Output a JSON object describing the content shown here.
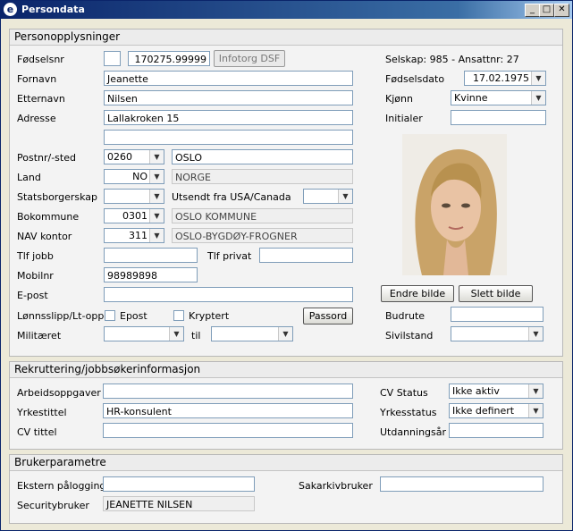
{
  "window": {
    "title": "Persondata",
    "minimize": "_",
    "maximize": "□",
    "close": "✕"
  },
  "sections": {
    "person": "Personopplysninger",
    "recruit": "Rekruttering/jobbsøkerinformasjon",
    "user": "Brukerparametre"
  },
  "person": {
    "fodselsnr": {
      "label": "Fødselsnr",
      "value": "170275.99999",
      "button": "Infotorg DSF"
    },
    "fornavn": {
      "label": "Fornavn",
      "value": "Jeanette"
    },
    "etternavn": {
      "label": "Etternavn",
      "value": "Nilsen"
    },
    "adresse": {
      "label": "Adresse",
      "value": "Lallakroken 15",
      "value2": ""
    },
    "postnr": {
      "label": "Postnr/-sted",
      "code": "0260",
      "place": "OSLO"
    },
    "land": {
      "label": "Land",
      "code": "NO",
      "name": "NORGE"
    },
    "statsborgerskap": {
      "label": "Statsborgerskap",
      "value": ""
    },
    "utsendt": {
      "label": "Utsendt fra USA/Canada",
      "value": ""
    },
    "bokommune": {
      "label": "Bokommune",
      "code": "0301",
      "name": "OSLO KOMMUNE"
    },
    "navkontor": {
      "label": "NAV kontor",
      "code": "311",
      "name": "OSLO-BYGDØY-FROGNER"
    },
    "tlfjobb": {
      "label": "Tlf jobb",
      "value": ""
    },
    "tlfprivat": {
      "label": "Tlf privat",
      "value": ""
    },
    "mobilnr": {
      "label": "Mobilnr",
      "value": "98989898"
    },
    "epost": {
      "label": "E-post",
      "value": ""
    },
    "lonnsslipp": {
      "label": "Lønnsslipp/Lt-oppg",
      "opt1": "Epost",
      "opt2": "Kryptert",
      "button": "Passord"
    },
    "militaeret": {
      "label": "Militæret",
      "from": "",
      "til_label": "til",
      "to": ""
    },
    "selskap": "Selskap: 985 - Ansattnr:  27",
    "fodselsdato": {
      "label": "Fødselsdato",
      "value": "17.02.1975"
    },
    "kjonn": {
      "label": "Kjønn",
      "value": "Kvinne"
    },
    "initialer": {
      "label": "Initialer",
      "value": ""
    },
    "photo_buttons": {
      "edit": "Endre bilde",
      "delete": "Slett bilde"
    },
    "budrute": {
      "label": "Budrute",
      "value": ""
    },
    "sivilstand": {
      "label": "Sivilstand",
      "value": ""
    }
  },
  "recruit": {
    "arbeidsoppgaver": {
      "label": "Arbeidsoppgaver",
      "value": ""
    },
    "yrkestittel": {
      "label": "Yrkestittel",
      "value": "HR-konsulent"
    },
    "cvtittel": {
      "label": "CV tittel",
      "value": ""
    },
    "cvstatus": {
      "label": "CV Status",
      "value": "Ikke aktiv"
    },
    "yrkesstatus": {
      "label": "Yrkesstatus",
      "value": "Ikke definert"
    },
    "utdanningsar": {
      "label": "Utdanningsår",
      "value": ""
    }
  },
  "user": {
    "ekstern": {
      "label": "Ekstern pålogging",
      "value": ""
    },
    "sakarkiv": {
      "label": "Sakarkivbruker",
      "value": ""
    },
    "security": {
      "label": "Securitybruker",
      "value": "JEANETTE NILSEN"
    }
  },
  "icons": {
    "app": "e-logo-icon",
    "dropdown": "chevron-down-icon"
  }
}
